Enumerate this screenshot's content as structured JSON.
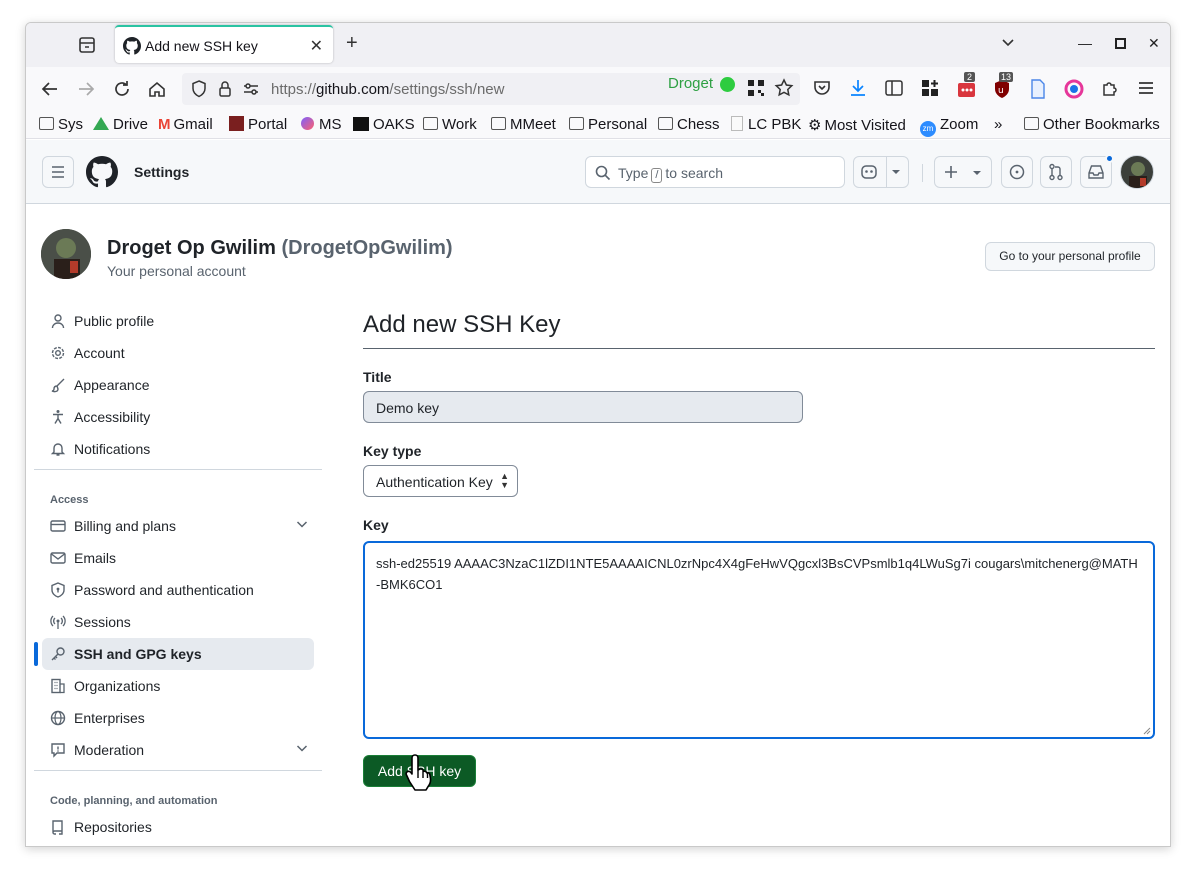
{
  "browser": {
    "tab_title": "Add new SSH key",
    "url_prefix": "https://",
    "url_host": "github.com",
    "url_path": "/settings/ssh/new",
    "extension_badge": "Droget",
    "ext_badge_count_1": "2",
    "ext_badge_count_2": "13"
  },
  "bookmarks": [
    {
      "label": "Sys"
    },
    {
      "label": "Drive"
    },
    {
      "label": "Gmail"
    },
    {
      "label": "Portal"
    },
    {
      "label": "MS"
    },
    {
      "label": "OAKS"
    },
    {
      "label": "Work"
    },
    {
      "label": "MMeet"
    },
    {
      "label": "Personal"
    },
    {
      "label": "Chess"
    },
    {
      "label": "LC PBK"
    },
    {
      "label": "Most Visited"
    },
    {
      "label": "Zoom"
    },
    {
      "label": "Other Bookmarks"
    }
  ],
  "header": {
    "context": "Settings",
    "search_before": "Type",
    "search_key": "/",
    "search_after": "to search"
  },
  "account": {
    "display_name": "Droget Op Gwilim",
    "login": "(DrogetOpGwilim)",
    "subtitle": "Your personal account",
    "profile_button": "Go to your personal profile"
  },
  "sidebar": {
    "items": [
      {
        "label": "Public profile"
      },
      {
        "label": "Account"
      },
      {
        "label": "Appearance"
      },
      {
        "label": "Accessibility"
      },
      {
        "label": "Notifications"
      }
    ],
    "access_heading": "Access",
    "access_items": [
      {
        "label": "Billing and plans"
      },
      {
        "label": "Emails"
      },
      {
        "label": "Password and authentication"
      },
      {
        "label": "Sessions"
      },
      {
        "label": "SSH and GPG keys"
      },
      {
        "label": "Organizations"
      },
      {
        "label": "Enterprises"
      },
      {
        "label": "Moderation"
      }
    ],
    "code_heading": "Code, planning, and automation",
    "code_items": [
      {
        "label": "Repositories"
      }
    ]
  },
  "form": {
    "page_title": "Add new SSH Key",
    "title_label": "Title",
    "title_value": "Demo key",
    "key_type_label": "Key type",
    "key_type_value": "Authentication Key",
    "key_label": "Key",
    "key_value": "ssh-ed25519 AAAAC3NzaC1lZDI1NTE5AAAAICNL0zrNpc4X4gFeHwVQgcxl3BsCVPsmlb1q4LWuSg7i cougars\\mitchenerg@MATH-BMK6CO1",
    "submit_label": "Add SSH key"
  },
  "colors": {
    "accent_blue": "#0969da",
    "button_green": "#0c5a25",
    "active_tab_indicator": "#2ac3a2"
  }
}
